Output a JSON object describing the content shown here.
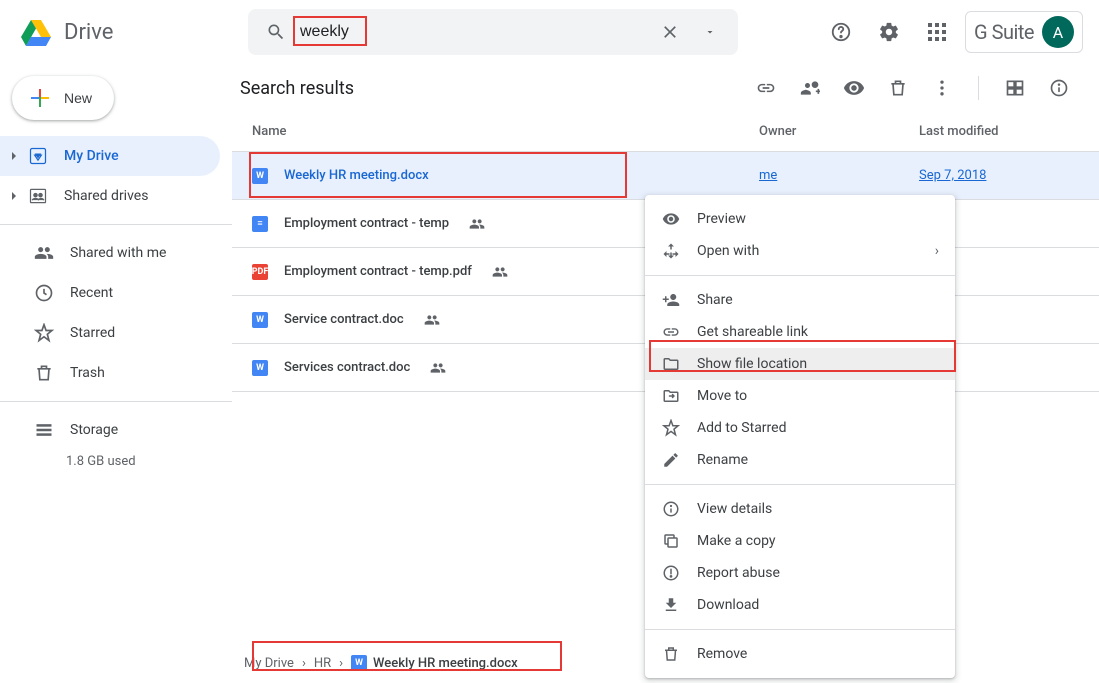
{
  "header": {
    "app_name": "Drive",
    "search_value": "weekly",
    "gsuite_label": "G Suite",
    "avatar_letter": "A"
  },
  "sidebar": {
    "new_label": "New",
    "items": [
      {
        "label": "My Drive",
        "icon": "mydrive",
        "active": true,
        "expandable": true
      },
      {
        "label": "Shared drives",
        "icon": "shared-drives",
        "active": false,
        "expandable": true
      }
    ],
    "secondary": [
      {
        "label": "Shared with me",
        "icon": "shared-with-me"
      },
      {
        "label": "Recent",
        "icon": "clock"
      },
      {
        "label": "Starred",
        "icon": "star"
      },
      {
        "label": "Trash",
        "icon": "trash"
      }
    ],
    "storage_label": "Storage",
    "storage_used": "1.8 GB used"
  },
  "main": {
    "title": "Search results",
    "columns": {
      "name": "Name",
      "owner": "Owner",
      "modified": "Last modified"
    },
    "files": [
      {
        "name": "Weekly HR meeting.docx",
        "type": "word",
        "owner": "me",
        "modified": "Sep 7, 2018",
        "shared": false,
        "selected": true
      },
      {
        "name": "Employment contract - temp",
        "type": "gdoc",
        "owner": "",
        "modified": "",
        "shared": true,
        "selected": false
      },
      {
        "name": "Employment contract - temp.pdf",
        "type": "pdf",
        "owner": "",
        "modified": "",
        "shared": true,
        "selected": false
      },
      {
        "name": "Service contract.doc",
        "type": "word",
        "owner": "",
        "modified": "",
        "shared": true,
        "selected": false
      },
      {
        "name": "Services contract.doc",
        "type": "word",
        "owner": "",
        "modified": "",
        "shared": true,
        "selected": false
      }
    ]
  },
  "breadcrumb": {
    "parts": [
      "My Drive",
      "HR"
    ],
    "current": "Weekly HR meeting.docx"
  },
  "context_menu": {
    "groups": [
      [
        {
          "label": "Preview",
          "icon": "eye"
        },
        {
          "label": "Open with",
          "icon": "open-with",
          "expand": true
        }
      ],
      [
        {
          "label": "Share",
          "icon": "person-add"
        },
        {
          "label": "Get shareable link",
          "icon": "link"
        },
        {
          "label": "Show file location",
          "icon": "folder",
          "highlighted": true
        },
        {
          "label": "Move to",
          "icon": "move"
        },
        {
          "label": "Add to Starred",
          "icon": "star"
        },
        {
          "label": "Rename",
          "icon": "rename"
        }
      ],
      [
        {
          "label": "View details",
          "icon": "info"
        },
        {
          "label": "Make a copy",
          "icon": "copy"
        },
        {
          "label": "Report abuse",
          "icon": "report"
        },
        {
          "label": "Download",
          "icon": "download"
        }
      ],
      [
        {
          "label": "Remove",
          "icon": "trash"
        }
      ]
    ]
  }
}
